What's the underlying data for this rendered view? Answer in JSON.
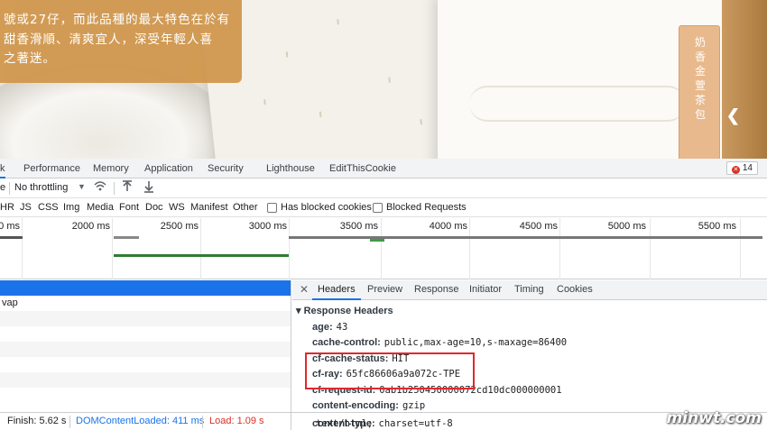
{
  "banner": {
    "lines": [
      "號或27仔，而此品種的最大特色在於有",
      "甜香滑順、清爽宜人，深受年輕人喜",
      "之著迷。"
    ],
    "pack_text": "奶香金萱茶包"
  },
  "devtools": {
    "tabs": [
      "k",
      "Performance",
      "Memory",
      "Application",
      "Security",
      "Lighthouse",
      "EditThisCookie"
    ],
    "error_count": "14",
    "toolbar": {
      "prefix": "e",
      "throttle": "No throttling"
    },
    "filters": [
      "HR",
      "JS",
      "CSS",
      "Img",
      "Media",
      "Font",
      "Doc",
      "WS",
      "Manifest",
      "Other"
    ],
    "checkbox_blocked_cookies": "Has blocked cookies",
    "checkbox_blocked_requests": "Blocked Requests",
    "timeline_ticks": [
      "0 ms",
      "2000 ms",
      "2500 ms",
      "3000 ms",
      "3500 ms",
      "4000 ms",
      "4500 ms",
      "5000 ms",
      "5500 ms"
    ],
    "requests": [
      "",
      "vap",
      "",
      "",
      "",
      "",
      ""
    ],
    "detail_tabs": [
      "Headers",
      "Preview",
      "Response",
      "Initiator",
      "Timing",
      "Cookies"
    ],
    "section_title": "Response Headers",
    "headers": [
      {
        "key": "age:",
        "value": "43"
      },
      {
        "key": "cache-control:",
        "value": "public,max-age=10,s-maxage=86400"
      },
      {
        "key": "cf-cache-status:",
        "value": "HIT"
      },
      {
        "key": "cf-ray:",
        "value": "65fc86606a9a072c-TPE"
      },
      {
        "key": "cf-request-id:",
        "value": "0ab1b250450000072cd10dc000000001"
      },
      {
        "key": "content-encoding:",
        "value": "gzip"
      },
      {
        "key": "content-type:",
        "value": "text/html; charset=utf-8"
      }
    ],
    "status": {
      "finish": "Finish: 5.62 s",
      "dom": "DOMContentLoaded: 411 ms",
      "load": "Load: 1.09 s"
    },
    "colors": {
      "accent": "#1a73e8",
      "highlight": "#e0282d",
      "dom": "#1a73e8",
      "load": "#d93025"
    }
  },
  "watermark": "minwt.com"
}
